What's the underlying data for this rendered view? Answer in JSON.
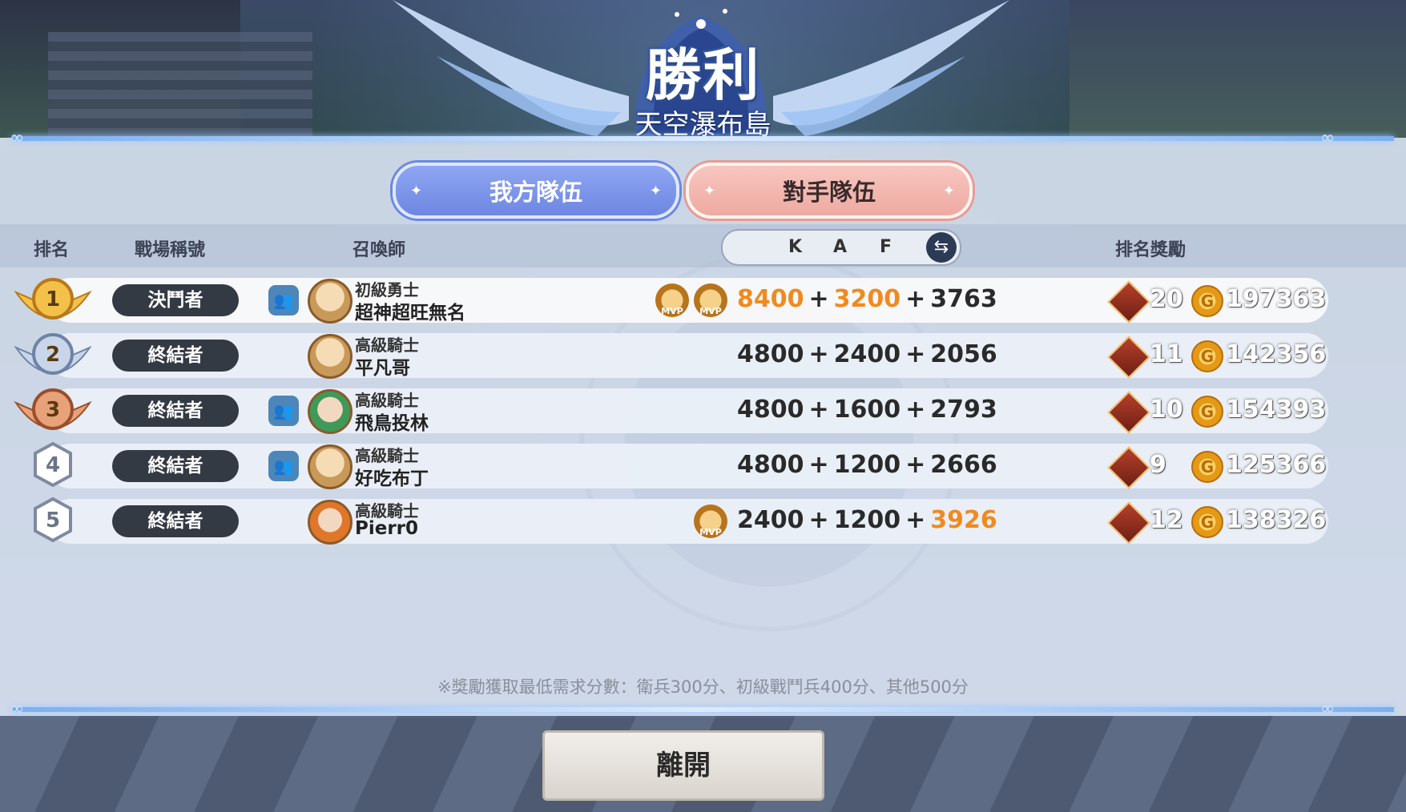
{
  "header": {
    "title": "勝利",
    "subtitle": "天空瀑布島"
  },
  "tabs": [
    {
      "label": "我方隊伍",
      "active": true
    },
    {
      "label": "對手隊伍",
      "active": false
    }
  ],
  "columns": {
    "rank": "排名",
    "battle_title": "戰場稱號",
    "summoner": "召喚師",
    "k": "K",
    "a": "A",
    "f": "F",
    "reward": "排名獎勵"
  },
  "rows": [
    {
      "rank": "1",
      "badge": "決鬥者",
      "level": "初級勇士",
      "name": "超神超旺無名",
      "party": true,
      "mvp_count": 2,
      "k": "8400",
      "a": "3200",
      "f": "3763",
      "k_hl": true,
      "a_hl": true,
      "f_hl": false,
      "chests": "20",
      "coins": "197363"
    },
    {
      "rank": "2",
      "badge": "終結者",
      "level": "高級騎士",
      "name": "平凡哥",
      "party": false,
      "mvp_count": 0,
      "k": "4800",
      "a": "2400",
      "f": "2056",
      "k_hl": false,
      "a_hl": false,
      "f_hl": false,
      "chests": "11",
      "coins": "142356"
    },
    {
      "rank": "3",
      "badge": "終結者",
      "level": "高級騎士",
      "name": "飛鳥投林",
      "party": true,
      "mvp_count": 0,
      "k": "4800",
      "a": "1600",
      "f": "2793",
      "k_hl": false,
      "a_hl": false,
      "f_hl": false,
      "chests": "10",
      "coins": "154393"
    },
    {
      "rank": "4",
      "badge": "終結者",
      "level": "高級騎士",
      "name": "好吃布丁",
      "party": true,
      "mvp_count": 0,
      "k": "4800",
      "a": "1200",
      "f": "2666",
      "k_hl": false,
      "a_hl": false,
      "f_hl": false,
      "chests": "9",
      "coins": "125366"
    },
    {
      "rank": "5",
      "badge": "終結者",
      "level": "高級騎士",
      "name": "Pierr0",
      "party": false,
      "mvp_count": 1,
      "k": "2400",
      "a": "1200",
      "f": "3926",
      "k_hl": false,
      "a_hl": false,
      "f_hl": true,
      "chests": "12",
      "coins": "138326"
    }
  ],
  "mvp_label": "MVP",
  "note": "※獎勵獲取最低需求分數：衛兵300分、初級戰鬥兵400分、其他500分",
  "leave_button": "離開",
  "colors": {
    "highlight": "#f08a1e",
    "tab_ours": "#7d96ea",
    "tab_opp": "#f2b6ae"
  }
}
